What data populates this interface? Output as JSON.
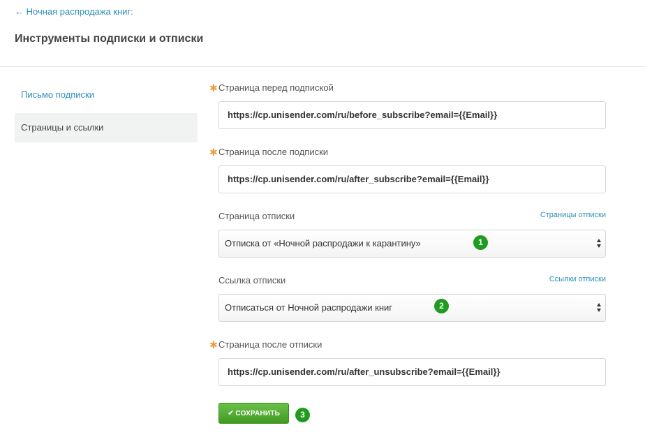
{
  "header": {
    "back_link": "← Ночная распродажа книг:",
    "title": "Инструменты подписки и отписки"
  },
  "sidebar": {
    "items": [
      {
        "label": "Письмо подписки",
        "active": false
      },
      {
        "label": "Страницы и ссылки",
        "active": true
      }
    ]
  },
  "form": {
    "before_subscribe": {
      "required_mark": "✱",
      "label": "Страница перед подпиской",
      "value": "https://cp.unisender.com/ru/before_subscribe?email={{Email}}"
    },
    "after_subscribe": {
      "required_mark": "✱",
      "label": "Страница после подписки",
      "value": "https://cp.unisender.com/ru/after_subscribe?email={{Email}}"
    },
    "unsubscribe_page": {
      "label": "Страница отписки",
      "aux_link": "Страницы отписки",
      "selected": "Отписка от «Ночной распродажи к карантину»",
      "badge": "1"
    },
    "unsubscribe_link": {
      "label": "Ссылка отписки",
      "aux_link": "Ссылки отписки",
      "selected": "Отписаться от Ночной распродажи книг",
      "badge": "2"
    },
    "after_unsubscribe": {
      "required_mark": "✱",
      "label": "Страница после отписки",
      "value": "https://cp.unisender.com/ru/after_unsubscribe?email={{Email}}"
    }
  },
  "actions": {
    "save_label": "СОХРАНИТЬ",
    "badge": "3"
  },
  "colors": {
    "link": "#2d8fb8",
    "required": "#e8a13a",
    "badge": "#1f9c1f",
    "save_button": "#4fa82e"
  }
}
